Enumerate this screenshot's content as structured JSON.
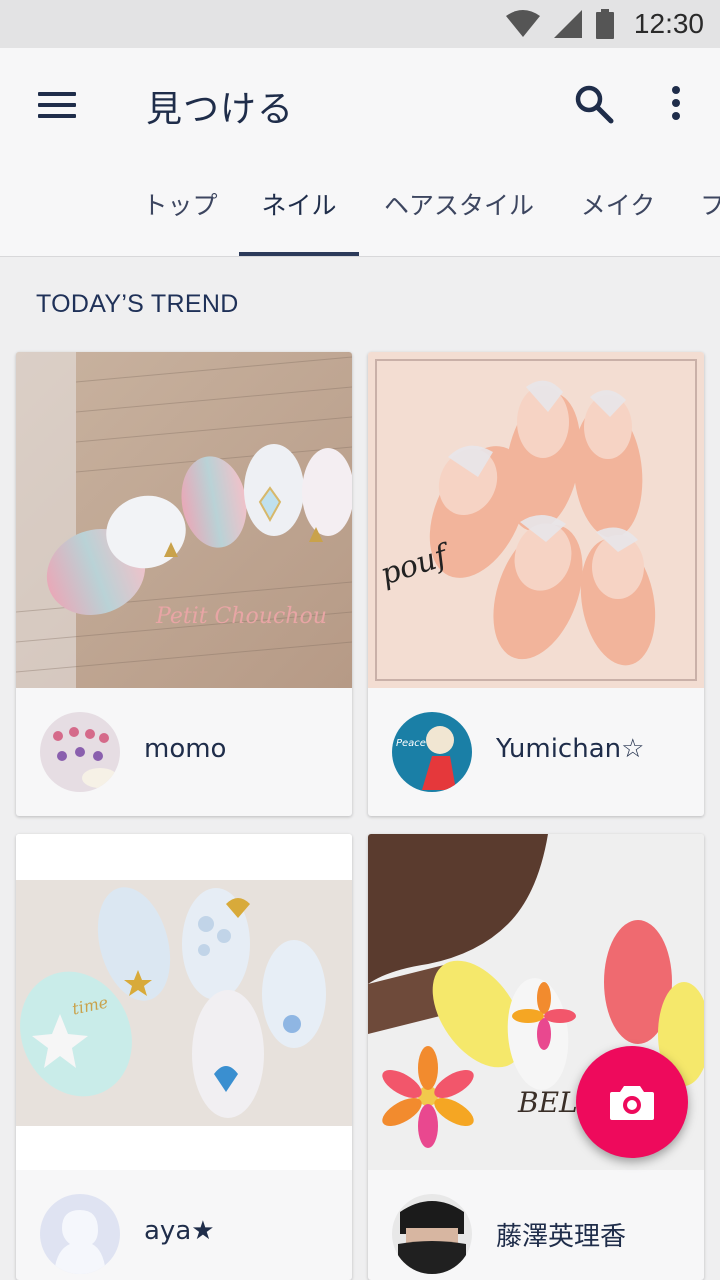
{
  "status_bar": {
    "time": "12:30",
    "icons": [
      "wifi-icon",
      "signal-icon",
      "battery-icon"
    ]
  },
  "app_bar": {
    "title": "見つける",
    "menu_icon": "menu-icon",
    "search_icon": "search-icon",
    "more_icon": "more-vert-icon"
  },
  "tabs": [
    {
      "label": "トップ",
      "active": false
    },
    {
      "label": "ネイル",
      "active": true
    },
    {
      "label": "ヘアスタイル",
      "active": false
    },
    {
      "label": "メイク",
      "active": false
    },
    {
      "label": "フ",
      "active": false
    }
  ],
  "section": {
    "title": "TODAY’S TREND"
  },
  "cards": [
    {
      "user": "momo",
      "image_text": "Petit Chouchou"
    },
    {
      "user": "Yumichan☆",
      "image_text": "pouf",
      "avatar_text": "Peace"
    },
    {
      "user": "aya★",
      "image_text": "time"
    },
    {
      "user": "藤澤英理香",
      "image_text": "BEL"
    }
  ],
  "fab": {
    "icon": "camera-icon"
  },
  "colors": {
    "accent": "#ee0a5c",
    "primary_text": "#1f2d4a",
    "indicator": "#2c3a5a",
    "app_bar_bg": "#f7f7f8",
    "page_bg": "#efeff0"
  }
}
